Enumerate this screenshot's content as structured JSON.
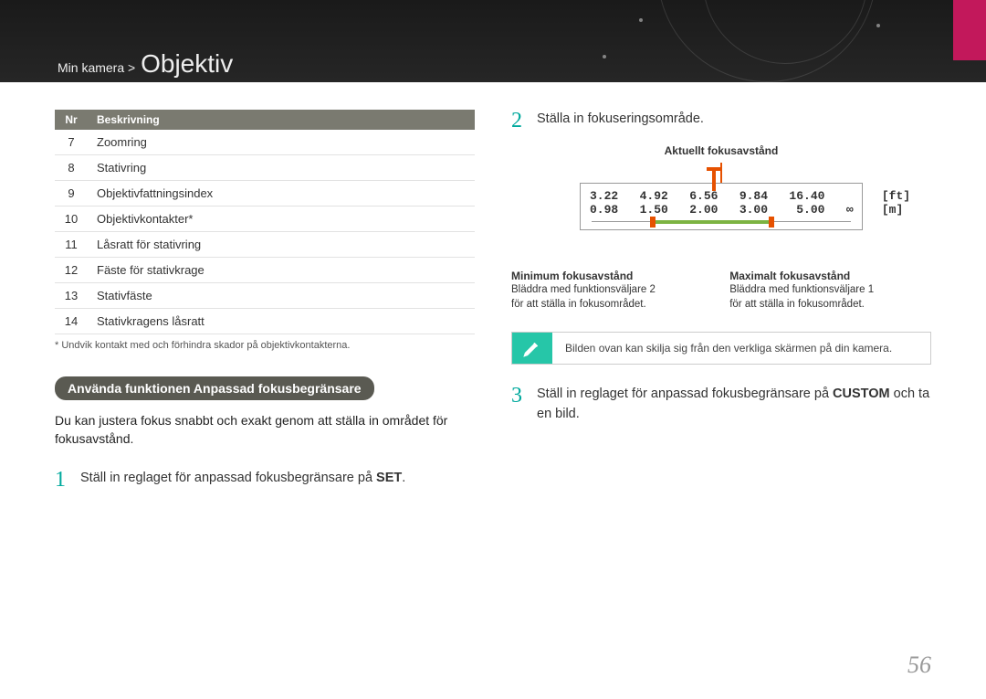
{
  "breadcrumb": {
    "path": "Min kamera >",
    "title": "Objektiv"
  },
  "table": {
    "headers": {
      "nr": "Nr",
      "beskrivning": "Beskrivning"
    },
    "rows": [
      {
        "nr": "7",
        "desc": "Zoomring"
      },
      {
        "nr": "8",
        "desc": "Stativring"
      },
      {
        "nr": "9",
        "desc": "Objektivfattningsindex"
      },
      {
        "nr": "10",
        "desc": "Objektivkontakter*"
      },
      {
        "nr": "11",
        "desc": "Låsratt för stativring"
      },
      {
        "nr": "12",
        "desc": "Fäste för stativkrage"
      },
      {
        "nr": "13",
        "desc": "Stativfäste"
      },
      {
        "nr": "14",
        "desc": "Stativkragens låsratt"
      }
    ],
    "footnote": "* Undvik kontakt med och förhindra skador på objektivkontakterna."
  },
  "section": {
    "pill": "Använda funktionen Anpassad fokusbegränsare"
  },
  "intro": "Du kan justera fokus snabbt och exakt genom att ställa in området för fokusavstånd.",
  "steps": {
    "s1_num": "1",
    "s1_a": "Ställ in reglaget för anpassad fokusbegränsare på ",
    "s1_b": "SET",
    "s1_c": ".",
    "s2_num": "2",
    "s2": "Ställa in fokuseringsområde.",
    "s3_num": "3",
    "s3_a": "Ställ in reglaget för anpassad fokusbegränsare på ",
    "s3_b": "CUSTOM",
    "s3_c": " och ta en bild."
  },
  "diagram": {
    "current": "Aktuellt fokusavstånd",
    "ft_row": "3.22   4.92   6.56   9.84   16.40        [ft]",
    "m_row": "0.98   1.50   2.00   3.00    5.00   ∞    [m]",
    "min_t": "Minimum fokusavstånd",
    "min_d1": "Bläddra med funktionsväljare 2",
    "min_d2": "för att ställa in fokusområdet.",
    "max_t": "Maximalt fokusavstånd",
    "max_d1": "Bläddra med funktionsväljare 1",
    "max_d2": "för att ställa in fokusområdet."
  },
  "note": "Bilden ovan kan skilja sig från den verkliga skärmen på din kamera.",
  "page": "56"
}
